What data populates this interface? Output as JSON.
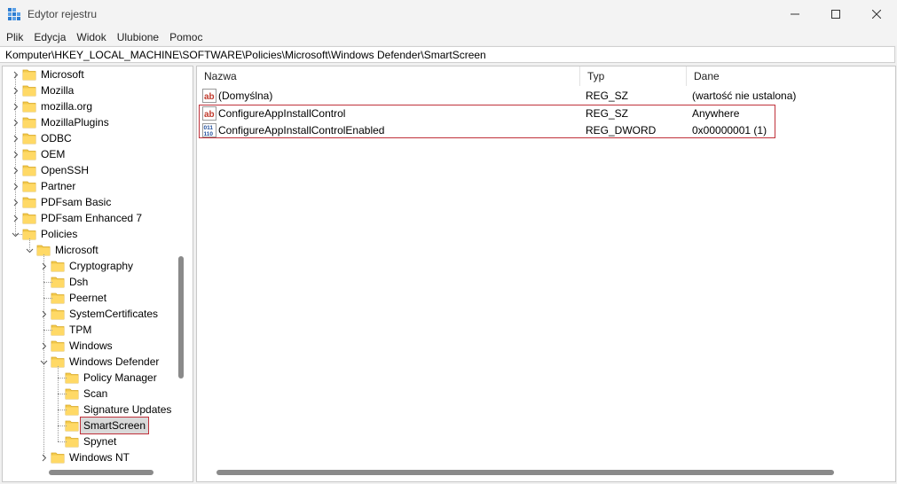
{
  "window": {
    "title": "Edytor rejestru"
  },
  "menu": [
    "Plik",
    "Edycja",
    "Widok",
    "Ulubione",
    "Pomoc"
  ],
  "address": "Komputer\\HKEY_LOCAL_MACHINE\\SOFTWARE\\Policies\\Microsoft\\Windows Defender\\SmartScreen",
  "tree": [
    {
      "label": "Microsoft",
      "level": 0,
      "state": "collapsed"
    },
    {
      "label": "Mozilla",
      "level": 0,
      "state": "collapsed"
    },
    {
      "label": "mozilla.org",
      "level": 0,
      "state": "collapsed"
    },
    {
      "label": "MozillaPlugins",
      "level": 0,
      "state": "collapsed"
    },
    {
      "label": "ODBC",
      "level": 0,
      "state": "collapsed"
    },
    {
      "label": "OEM",
      "level": 0,
      "state": "collapsed"
    },
    {
      "label": "OpenSSH",
      "level": 0,
      "state": "collapsed"
    },
    {
      "label": "Partner",
      "level": 0,
      "state": "collapsed"
    },
    {
      "label": "PDFsam Basic",
      "level": 0,
      "state": "collapsed"
    },
    {
      "label": "PDFsam Enhanced 7",
      "level": 0,
      "state": "collapsed"
    },
    {
      "label": "Policies",
      "level": 0,
      "state": "expanded"
    },
    {
      "label": "Microsoft",
      "level": 1,
      "state": "expanded"
    },
    {
      "label": "Cryptography",
      "level": 2,
      "state": "collapsed"
    },
    {
      "label": "Dsh",
      "level": 2,
      "state": "leaf"
    },
    {
      "label": "Peernet",
      "level": 2,
      "state": "leaf"
    },
    {
      "label": "SystemCertificates",
      "level": 2,
      "state": "collapsed"
    },
    {
      "label": "TPM",
      "level": 2,
      "state": "leaf"
    },
    {
      "label": "Windows",
      "level": 2,
      "state": "collapsed"
    },
    {
      "label": "Windows Defender",
      "level": 2,
      "state": "expanded"
    },
    {
      "label": "Policy Manager",
      "level": 3,
      "state": "leaf"
    },
    {
      "label": "Scan",
      "level": 3,
      "state": "leaf"
    },
    {
      "label": "Signature Updates",
      "level": 3,
      "state": "leaf"
    },
    {
      "label": "SmartScreen",
      "level": 3,
      "state": "leaf",
      "selected": true
    },
    {
      "label": "Spynet",
      "level": 3,
      "state": "leaf"
    },
    {
      "label": "Windows NT",
      "level": 2,
      "state": "collapsed"
    }
  ],
  "columns": [
    "Nazwa",
    "Typ",
    "Dane"
  ],
  "values": [
    {
      "name": "(Domyślna)",
      "type": "REG_SZ",
      "data": "(wartość nie ustalona)",
      "icon": "string-value-icon"
    },
    {
      "name": "ConfigureAppInstallControl",
      "type": "REG_SZ",
      "data": "Anywhere",
      "icon": "string-value-icon"
    },
    {
      "name": "ConfigureAppInstallControlEnabled",
      "type": "REG_DWORD",
      "data": "0x00000001 (1)",
      "icon": "binary-value-icon"
    }
  ],
  "colors": {
    "highlight": "#c0313a",
    "folder": "#f2c94c",
    "accent": "#0067c0"
  }
}
